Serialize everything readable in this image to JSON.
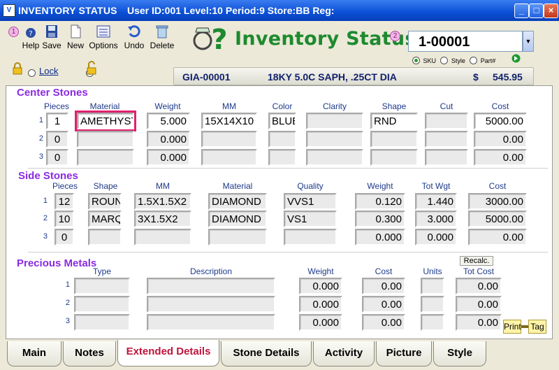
{
  "window": {
    "title": "INVENTORY STATUS",
    "info": "User ID:001 Level:10 Period:9 Store:BB Reg:",
    "icon_label": "V"
  },
  "toolbar": {
    "help_label": "Help",
    "save_label": "Save",
    "new_label": "New",
    "options_label": "Options",
    "undo_label": "Undo",
    "delete_label": "Delete",
    "marker1": "1",
    "marker2": "2"
  },
  "lock": {
    "label": "Lock"
  },
  "header": {
    "app_title": "Inventory Status",
    "item_number": "1-00001",
    "lookup_options": [
      "SKU",
      "Style",
      "Part#"
    ],
    "lookup_selected": "SKU"
  },
  "infobar": {
    "sku": "GIA-00001",
    "description": "18KY 5.0C SAPH, .25CT DIA",
    "currency": "$",
    "price": "545.95"
  },
  "center_stones": {
    "title": "Center Stones",
    "columns": [
      "Pieces",
      "Material",
      "Weight",
      "MM",
      "Color",
      "Clarity",
      "Shape",
      "Cut",
      "Cost"
    ],
    "rows": [
      {
        "n": "1",
        "pieces": "1",
        "material": "AMETHYST",
        "weight": "5.000",
        "mm": "15X14X10",
        "color": "BLUE",
        "clarity": "",
        "shape": "RND",
        "cut": "",
        "cost": "5000.00"
      },
      {
        "n": "2",
        "pieces": "0",
        "material": "",
        "weight": "0.000",
        "mm": "",
        "color": "",
        "clarity": "",
        "shape": "",
        "cut": "",
        "cost": "0.00"
      },
      {
        "n": "3",
        "pieces": "0",
        "material": "",
        "weight": "0.000",
        "mm": "",
        "color": "",
        "clarity": "",
        "shape": "",
        "cut": "",
        "cost": "0.00"
      }
    ]
  },
  "side_stones": {
    "title": "Side Stones",
    "columns": [
      "Pieces",
      "Shape",
      "MM",
      "Material",
      "Quality",
      "Weight",
      "Tot Wgt",
      "Cost"
    ],
    "rows": [
      {
        "n": "1",
        "pieces": "12",
        "shape": "ROUND",
        "mm": "1.5X1.5X2",
        "material": "DIAMOND",
        "quality": "VVS1",
        "weight": "0.120",
        "tot_wgt": "1.440",
        "cost": "3000.00"
      },
      {
        "n": "2",
        "pieces": "10",
        "shape": "MARQ",
        "mm": "3X1.5X2",
        "material": "DIAMOND",
        "quality": "VS1",
        "weight": "0.300",
        "tot_wgt": "3.000",
        "cost": "5000.00"
      },
      {
        "n": "3",
        "pieces": "0",
        "shape": "",
        "mm": "",
        "material": "",
        "quality": "",
        "weight": "0.000",
        "tot_wgt": "0.000",
        "cost": "0.00"
      }
    ]
  },
  "precious_metals": {
    "title": "Precious Metals",
    "columns": [
      "Type",
      "Description",
      "Weight",
      "Cost",
      "Units",
      "Tot Cost"
    ],
    "recalc_label": "Recalc.",
    "rows": [
      {
        "n": "1",
        "type": "",
        "description": "",
        "weight": "0.000",
        "cost": "0.00",
        "units": "",
        "tot_cost": "0.00"
      },
      {
        "n": "2",
        "type": "",
        "description": "",
        "weight": "0.000",
        "cost": "0.00",
        "units": "",
        "tot_cost": "0.00"
      },
      {
        "n": "3",
        "type": "",
        "description": "",
        "weight": "0.000",
        "cost": "0.00",
        "units": "",
        "tot_cost": "0.00"
      }
    ]
  },
  "print_tag": {
    "print": "Print",
    "tag": "Tag"
  },
  "tabs": [
    {
      "label": "Main"
    },
    {
      "label": "Notes"
    },
    {
      "label": "Extended Details",
      "active": true
    },
    {
      "label": "Stone Details"
    },
    {
      "label": "Activity"
    },
    {
      "label": "Picture"
    },
    {
      "label": "Style"
    }
  ]
}
